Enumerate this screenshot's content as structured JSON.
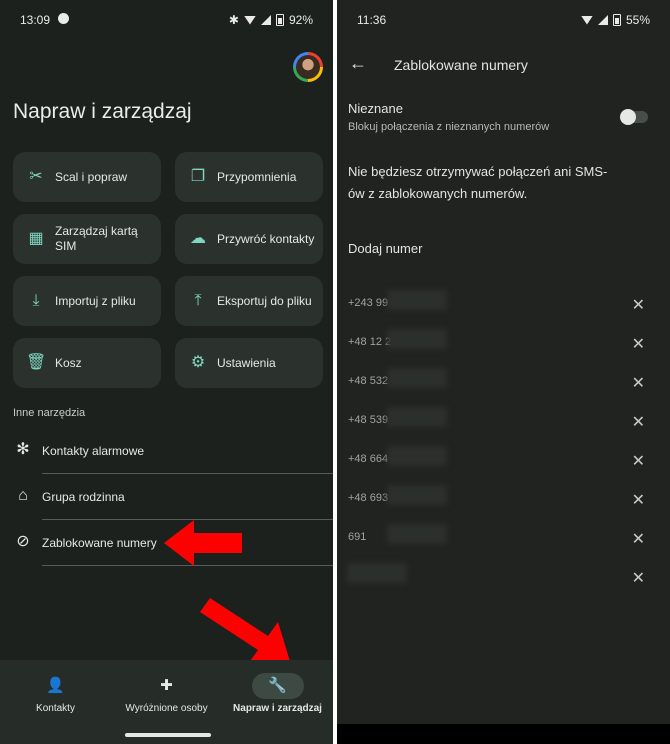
{
  "left": {
    "status": {
      "time": "13:09",
      "battery": "92%"
    },
    "title": "Napraw i zarządzaj",
    "cards": [
      {
        "label": "Scal i popraw",
        "icon": "merge-tools-icon"
      },
      {
        "label": "Przypomnienia",
        "icon": "copy-icon"
      },
      {
        "label": "Zarządzaj kartą SIM",
        "icon": "sim-card-icon"
      },
      {
        "label": "Przywróć kontakty",
        "icon": "cloud-restore-icon"
      },
      {
        "label": "Importuj z pliku",
        "icon": "download-icon"
      },
      {
        "label": "Eksportuj do pliku",
        "icon": "upload-icon"
      },
      {
        "label": "Kosz",
        "icon": "trash-icon"
      },
      {
        "label": "Ustawienia",
        "icon": "gear-icon"
      }
    ],
    "other_tools_label": "Inne narzędzia",
    "tools": [
      {
        "label": "Kontakty alarmowe",
        "icon": "emergency-icon"
      },
      {
        "label": "Grupa rodzinna",
        "icon": "family-home-icon"
      },
      {
        "label": "Zablokowane numery",
        "icon": "block-icon"
      }
    ],
    "nav": [
      {
        "label": "Kontakty",
        "icon": "person-icon"
      },
      {
        "label": "Wyróżnione osoby",
        "icon": "highlight-icon"
      },
      {
        "label": "Napraw i zarządzaj",
        "icon": "wrench-icon"
      }
    ]
  },
  "right": {
    "status": {
      "time": "11:36",
      "battery": "55%"
    },
    "title": "Zablokowane numery",
    "unknown_title": "Nieznane",
    "unknown_sub": "Blokuj połączenia z nieznanych numerów",
    "info": "Nie będziesz otrzymywać połączeń ani SMS-ów z zablokowanych numerów.",
    "add_number": "Dodaj numer",
    "numbers": [
      "+243 99",
      "+48 12 2",
      "+48 532",
      "+48 539",
      "+48 664",
      "+48 693",
      "691",
      ""
    ]
  },
  "accent": "#7fd6c3",
  "arrow_color": "#ff0000"
}
